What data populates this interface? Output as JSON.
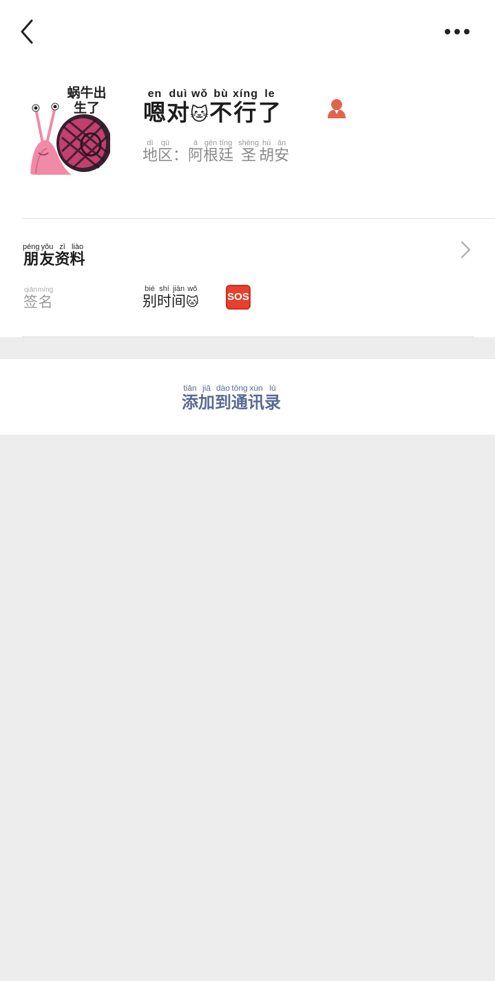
{
  "profile": {
    "nickname": [
      {
        "char": "嗯",
        "py": "en"
      },
      {
        "char": "对",
        "py": "duì"
      },
      {
        "char": "🐱",
        "py": "wǒ"
      },
      {
        "char": "不",
        "py": "bù"
      },
      {
        "char": "行",
        "py": "xíng"
      },
      {
        "char": "了",
        "py": "le"
      }
    ],
    "region": [
      {
        "char": "地",
        "py": "dì"
      },
      {
        "char": "区",
        "py": "qū"
      },
      {
        "char": "：",
        "py": ""
      },
      {
        "char": "阿",
        "py": "ā"
      },
      {
        "char": "根",
        "py": "gēn"
      },
      {
        "char": "廷",
        "py": "tíng"
      },
      {
        "char": " ",
        "py": ""
      },
      {
        "char": "圣",
        "py": "shèng"
      },
      {
        "char": "胡",
        "py": "hú"
      },
      {
        "char": "安",
        "py": "ān"
      }
    ],
    "avatar_caption": "蜗牛出生了",
    "avatar_caption_line1": "蜗牛出",
    "avatar_caption_line2": "生了"
  },
  "friend_info": {
    "label": [
      {
        "char": "朋",
        "py": "péng"
      },
      {
        "char": "友",
        "py": "yǒu"
      },
      {
        "char": "资",
        "py": "zī"
      },
      {
        "char": "料",
        "py": "liào"
      }
    ]
  },
  "signature": {
    "label": [
      {
        "char": "签",
        "py": "qiān"
      },
      {
        "char": "名",
        "py": "míng"
      }
    ],
    "value": [
      {
        "char": "别",
        "py": "bié"
      },
      {
        "char": "时",
        "py": "shí"
      },
      {
        "char": "间",
        "py": "jiān"
      },
      {
        "char": "🐱",
        "py": "wǒ"
      }
    ],
    "badge": "SOS"
  },
  "add_contact": {
    "label": [
      {
        "char": "添",
        "py": "tiān"
      },
      {
        "char": "加",
        "py": "jiā"
      },
      {
        "char": "到",
        "py": "dào"
      },
      {
        "char": "通",
        "py": "tōng"
      },
      {
        "char": "讯",
        "py": "xùn"
      },
      {
        "char": "录",
        "py": "lù"
      }
    ]
  },
  "icons": {
    "back": "chevron-left-icon",
    "more": "more-dots-icon",
    "person": "person-icon",
    "chevron": "chevron-right-icon"
  },
  "colors": {
    "link_blue": "#586a96",
    "badge_red": "#e8402f",
    "person_icon": "#e0634e",
    "background": "#ededed"
  }
}
